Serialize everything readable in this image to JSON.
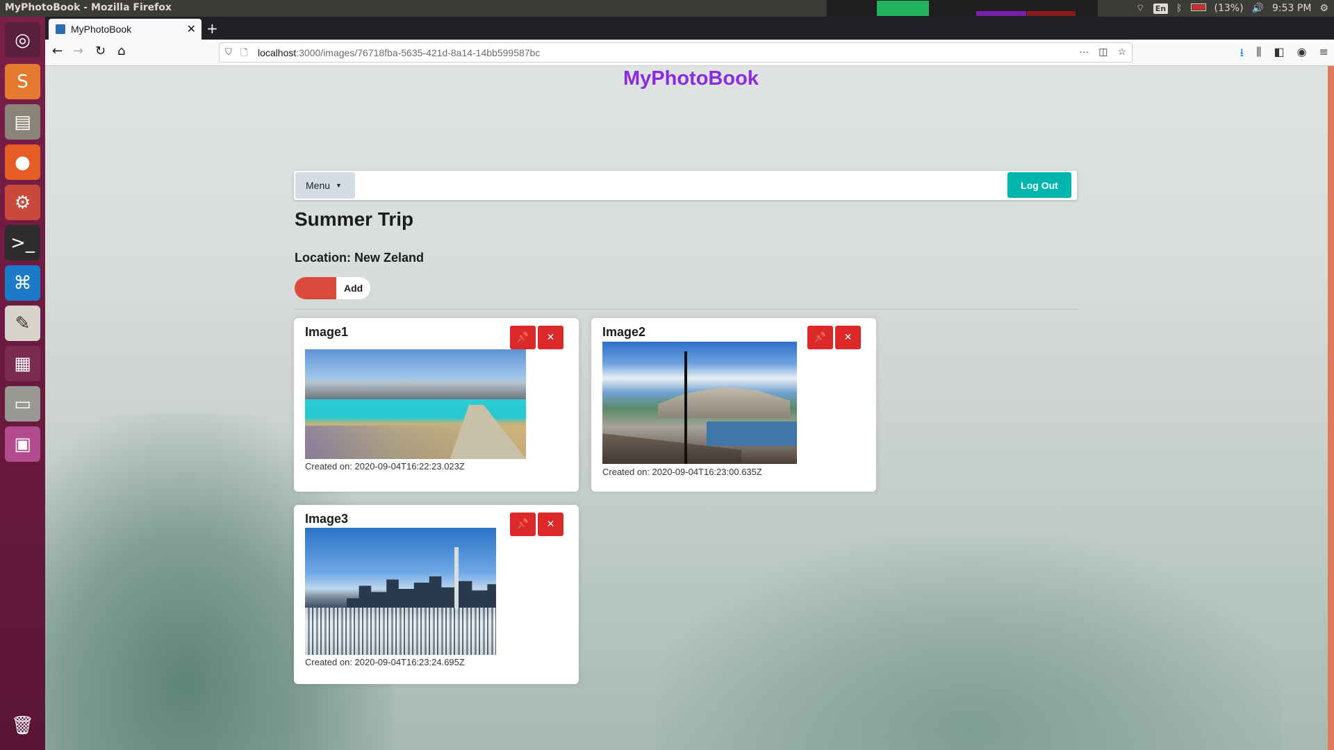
{
  "system": {
    "window_title": "MyPhotoBook - Mozilla Firefox",
    "battery": "(13%)",
    "time": "9:53 PM",
    "keyboard": "En"
  },
  "launcher": {
    "icons": [
      "ubuntu-icon",
      "sublime-icon",
      "files-icon",
      "firefox-icon",
      "settings-icon",
      "terminal-icon",
      "vscode-icon",
      "text-editor-icon",
      "workspace-icon",
      "disk-icon",
      "software-icon",
      "trash-icon"
    ]
  },
  "browser": {
    "tab_title": "MyPhotoBook",
    "url_host": "localhost",
    "url_rest": ":3000/images/76718fba-5635-421d-8a14-14bb599587bc"
  },
  "app": {
    "title": "MyPhotoBook",
    "menu_label": "Menu",
    "logout_label": "Log Out",
    "album_title": "Summer Trip",
    "location": "Location: New Zeland",
    "add_label": "Add",
    "accent_color": "#8a2be2",
    "danger_color": "#db2828",
    "teal_color": "#00b5ad"
  },
  "images": [
    {
      "name": "Image1",
      "created": "Created on: 2020-09-04T16:22:23.023Z"
    },
    {
      "name": "Image2",
      "created": "Created on: 2020-09-04T16:23:00.635Z"
    },
    {
      "name": "Image3",
      "created": "Created on: 2020-09-04T16:23:24.695Z"
    }
  ]
}
